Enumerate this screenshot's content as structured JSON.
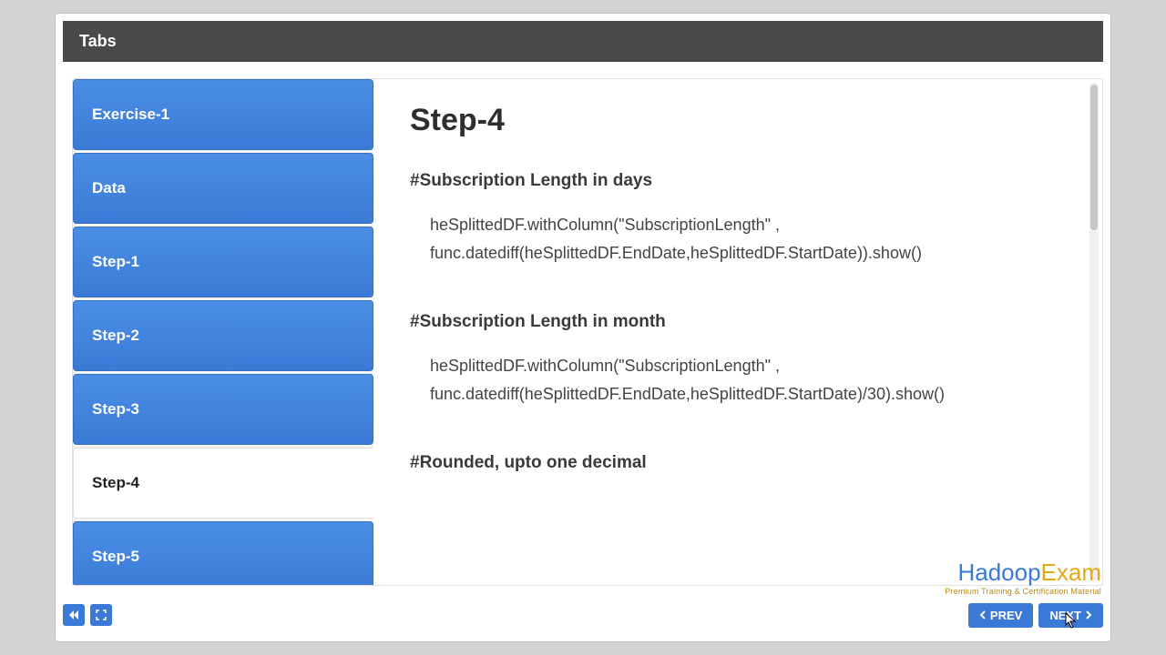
{
  "header": {
    "title": "Tabs"
  },
  "tabs": [
    {
      "label": "Exercise-1"
    },
    {
      "label": "Data"
    },
    {
      "label": "Step-1"
    },
    {
      "label": "Step-2"
    },
    {
      "label": "Step-3"
    },
    {
      "label": "Step-4"
    },
    {
      "label": "Step-5"
    }
  ],
  "active_tab_index": 5,
  "content": {
    "heading": "Step-4",
    "sections": [
      {
        "label": "#Subscription Length in days",
        "code": "heSplittedDF.withColumn(\"SubscriptionLength\" , func.datediff(heSplittedDF.EndDate,heSplittedDF.StartDate)).show()"
      },
      {
        "label": "#Subscription Length in month",
        "code": "heSplittedDF.withColumn(\"SubscriptionLength\" , func.datediff(heSplittedDF.EndDate,heSplittedDF.StartDate)/30).show()"
      },
      {
        "label": "#Rounded, upto one decimal",
        "code": ""
      }
    ]
  },
  "nav": {
    "prev": "PREV",
    "next": "NEXT"
  },
  "logo": {
    "brand_h": "Hadoop",
    "brand_e": "Exam",
    "tagline": "Premium Training & Certification Material"
  }
}
